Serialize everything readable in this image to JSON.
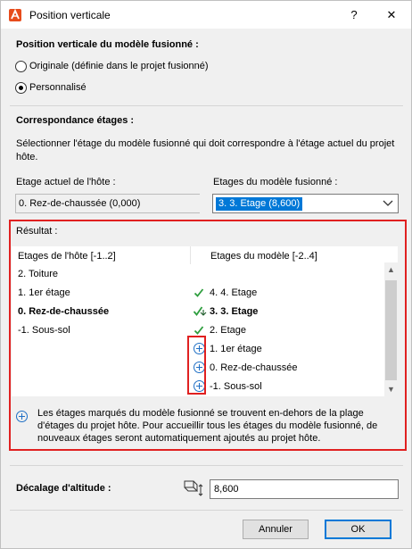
{
  "window": {
    "title": "Position verticale",
    "help_label": "?",
    "close_label": "✕",
    "icon": "archicad-app-icon"
  },
  "vertical_position": {
    "heading": "Position verticale du modèle fusionné :",
    "options": [
      {
        "label": "Originale (définie dans le projet fusionné)",
        "selected": false
      },
      {
        "label": "Personnalisé",
        "selected": true
      }
    ]
  },
  "story_mapping": {
    "heading": "Correspondance étages :",
    "description": "Sélectionner l'étage du modèle fusionné qui doit correspondre à l'étage actuel du projet hôte.",
    "host_label": "Etage actuel de l'hôte :",
    "host_value": "0. Rez-de-chaussée (0,000)",
    "model_label": "Etages du modèle fusionné :",
    "model_value": "3. 3. Etage (8,600)"
  },
  "result": {
    "label": "Résultat :",
    "col_host": "Etages de l'hôte [-1..2]",
    "col_model": "Etages du modèle [-2..4]",
    "host_rows": [
      {
        "text": "2. Toiture",
        "bold": false
      },
      {
        "text": "1. 1er étage",
        "bold": false
      },
      {
        "text": "0. Rez-de-chaussée",
        "bold": true
      },
      {
        "text": "-1. Sous-sol",
        "bold": false
      }
    ],
    "model_rows": [
      {
        "text": "4. 4. Etage",
        "bold": false,
        "icon": "check-icon"
      },
      {
        "text": "3. 3. Etage",
        "bold": true,
        "icon": "check-anchor-icon"
      },
      {
        "text": "2. Etage",
        "bold": false,
        "icon": "check-icon"
      },
      {
        "text": "1. 1er étage",
        "bold": false,
        "icon": "plus-circle-icon"
      },
      {
        "text": "0. Rez-de-chaussée",
        "bold": false,
        "icon": "plus-circle-icon"
      },
      {
        "text": "-1. Sous-sol",
        "bold": false,
        "icon": "plus-circle-icon"
      }
    ],
    "info": "Les étages marqués du modèle fusionné se trouvent en-dehors de la plage d'étages du projet hôte. Pour accueillir tous les étages du modèle fusionné, de nouveaux étages seront automatiquement ajoutés au projet hôte."
  },
  "elevation": {
    "label": "Décalage d'altitude :",
    "value": "8,600",
    "icon": "elevation-offset-icon"
  },
  "buttons": {
    "cancel": "Annuler",
    "ok": "OK"
  },
  "colors": {
    "highlight_red": "#e02020",
    "check_green": "#2e9e3e",
    "selection_blue": "#0078d7",
    "plus_blue": "#1f6fc5"
  }
}
